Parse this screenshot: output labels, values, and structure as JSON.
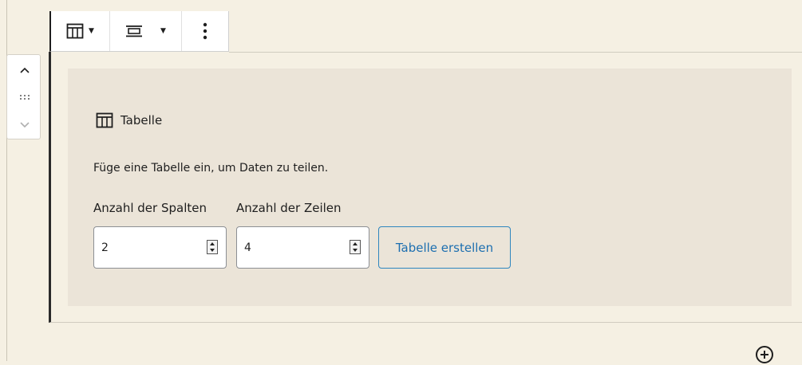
{
  "toolbar": {
    "table_icon": "table-icon",
    "align_icon": "align-center-icon",
    "more_icon": "more-vertical-icon"
  },
  "mover": {
    "up_icon": "chevron-up-icon",
    "drag_icon": "drag-handle-icon",
    "down_icon": "chevron-down-icon"
  },
  "placeholder": {
    "title": "Tabelle",
    "description": "Füge eine Tabelle ein, um Daten zu teilen.",
    "columns_label": "Anzahl der Spalten",
    "rows_label": "Anzahl der Zeilen",
    "columns_value": "2",
    "rows_value": "4",
    "create_button": "Tabelle erstellen"
  },
  "add_block_icon": "plus-circle-icon",
  "colors": {
    "background": "#f5f0e3",
    "placeholder_bg": "#ebe4d8",
    "accent": "#1d6fb0"
  }
}
